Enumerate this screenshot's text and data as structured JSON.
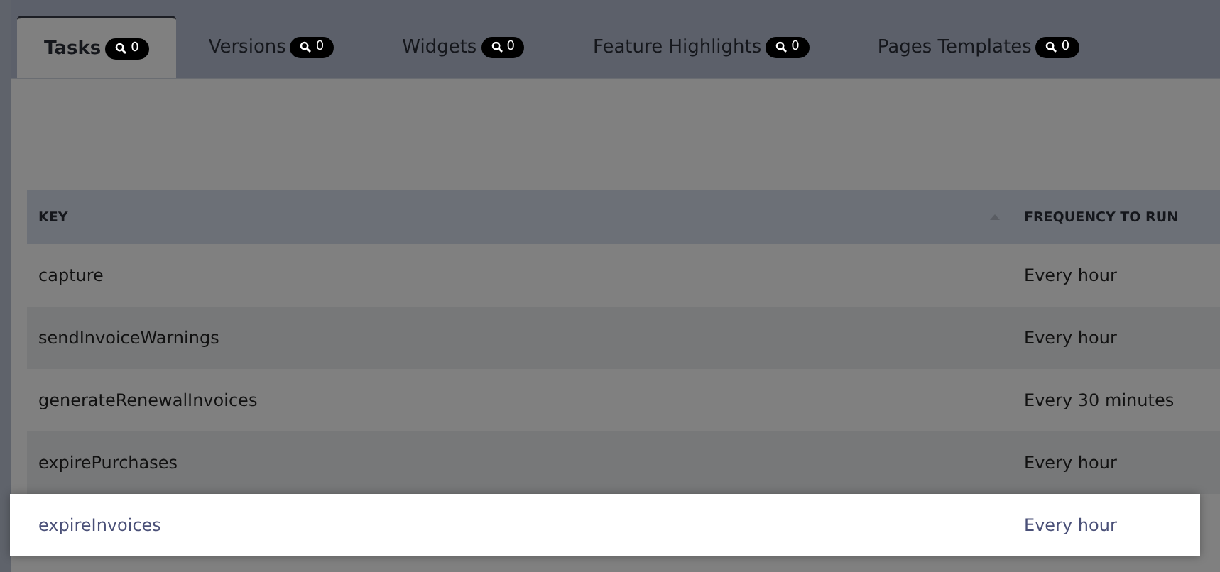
{
  "tabs": [
    {
      "label": "Tasks",
      "count": "0",
      "selected": true
    },
    {
      "label": "Versions",
      "count": "0",
      "selected": false
    },
    {
      "label": "Widgets",
      "count": "0",
      "selected": false
    },
    {
      "label": "Feature Highlights",
      "count": "0",
      "selected": false
    },
    {
      "label": "Pages Templates",
      "count": "0",
      "selected": false
    }
  ],
  "table": {
    "columns": [
      {
        "label": "KEY",
        "sorted": true
      },
      {
        "label": "FREQUENCY TO RUN",
        "sorted": false
      }
    ],
    "rows": [
      {
        "key": "capture",
        "frequency": "Every hour",
        "highlighted": false
      },
      {
        "key": "sendInvoiceWarnings",
        "frequency": "Every hour",
        "highlighted": false
      },
      {
        "key": "generateRenewalInvoices",
        "frequency": "Every 30 minutes",
        "highlighted": false
      },
      {
        "key": "expirePurchases",
        "frequency": "Every hour",
        "highlighted": false
      },
      {
        "key": "expireInvoices",
        "frequency": "Every hour",
        "highlighted": true
      }
    ]
  }
}
